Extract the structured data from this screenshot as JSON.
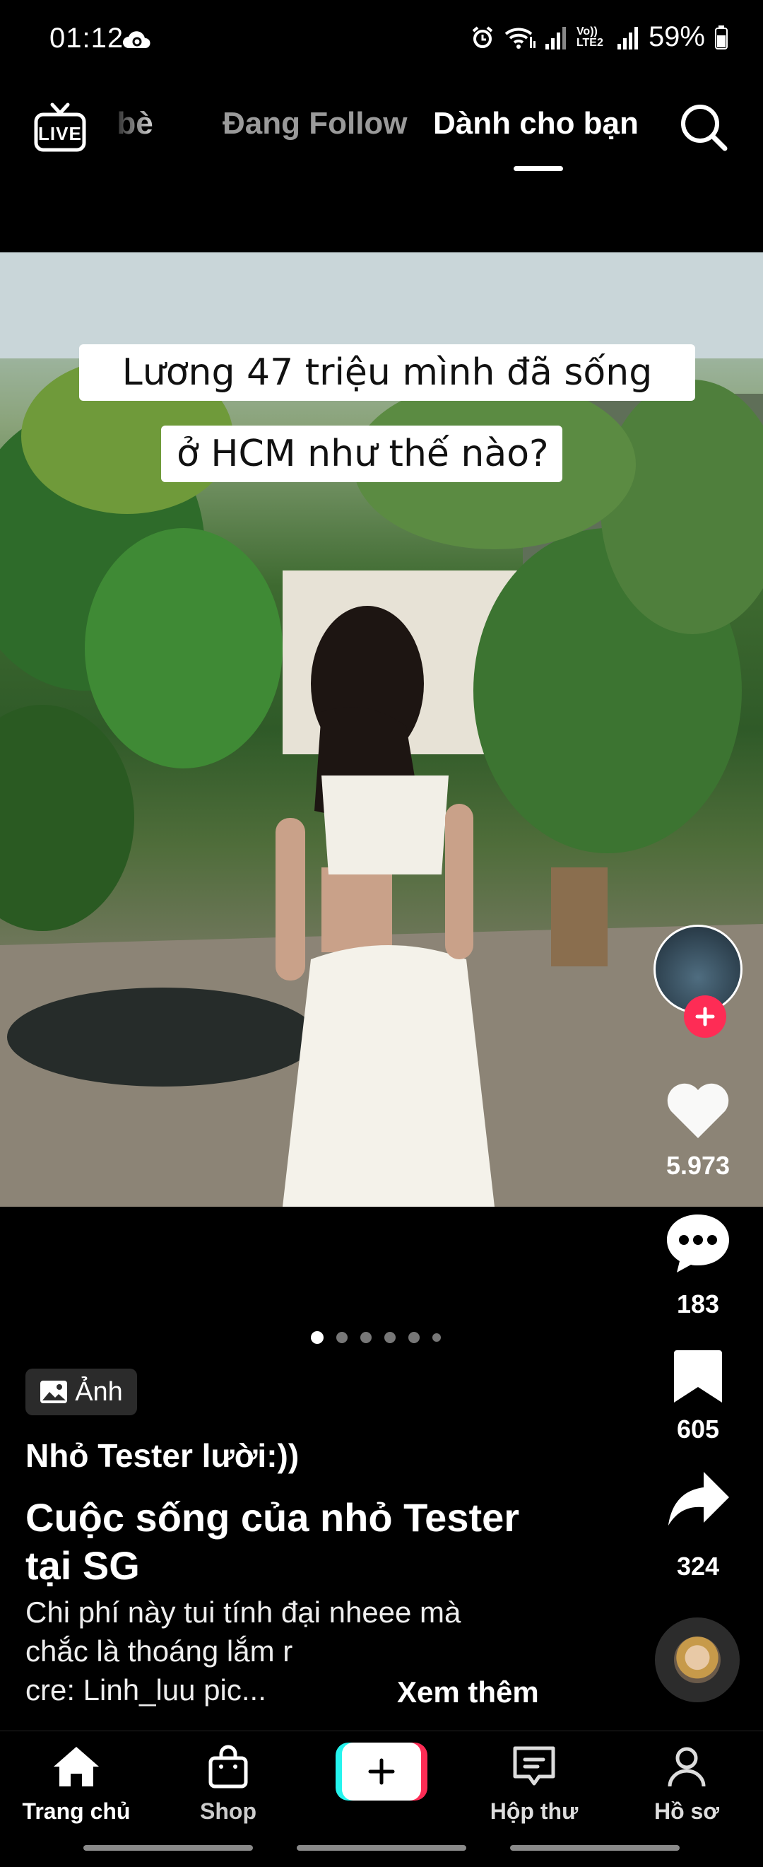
{
  "status": {
    "time": "01:12",
    "network_label": "Vo)) LTE2",
    "battery": "59%"
  },
  "top_nav": {
    "tabs": [
      {
        "label": "Bạn bè"
      },
      {
        "label": "Đang Follow"
      },
      {
        "label": "Dành cho bạn"
      }
    ],
    "live_label": "LIVE"
  },
  "post": {
    "caption_line_1": "Lương 47 triệu mình đã sống",
    "caption_line_2": "ở HCM như thế nào?",
    "photo_badge": "Ảnh",
    "username": "Nhỏ Tester lười:))",
    "title": "Cuộc sống của nhỏ Tester tại SG",
    "description_lines": [
      "Chi phí này tui tính đại nheee mà",
      "chắc là thoáng lắm r",
      "cre: Linh_luu pic..."
    ],
    "see_more": "Xem thêm",
    "carousel": {
      "total": 6,
      "active_index": 0
    }
  },
  "actions": {
    "likes": "5.973",
    "comments": "183",
    "saves": "605",
    "shares": "324"
  },
  "bottom_nav": {
    "items": [
      {
        "label": "Trang chủ"
      },
      {
        "label": "Shop"
      },
      {
        "label": ""
      },
      {
        "label": "Hộp thư"
      },
      {
        "label": "Hồ sơ"
      }
    ]
  },
  "colors": {
    "background": "#000000",
    "create_button_left": "#25F4EE",
    "create_button_right": "#FE2C55",
    "follow_plus": "#FE2C55",
    "inactive_tab": "#9a9a9a"
  }
}
